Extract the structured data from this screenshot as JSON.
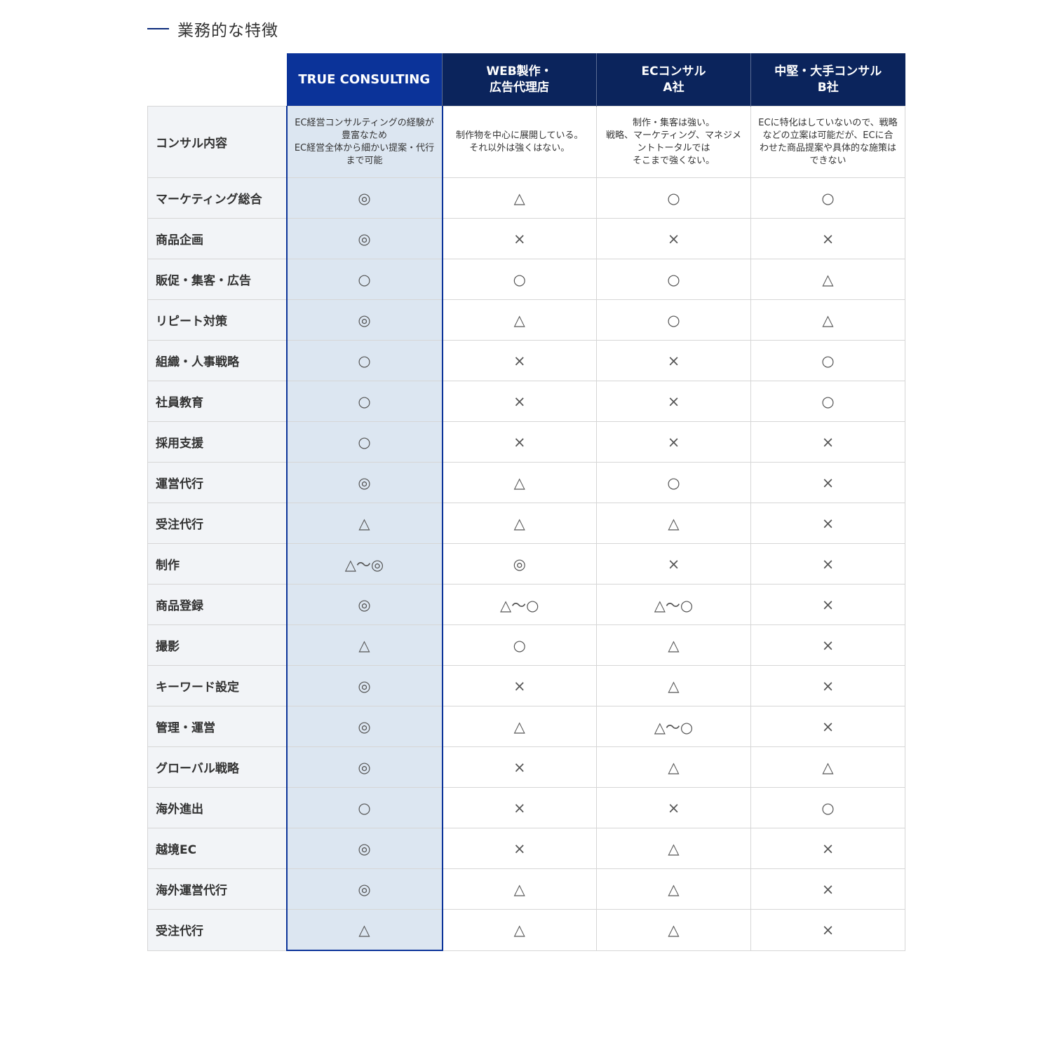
{
  "heading": "業務的な特徴",
  "columns": [
    {
      "line1": "TRUE CONSULTING",
      "line2": ""
    },
    {
      "line1": "WEB製作・",
      "line2": "広告代理店"
    },
    {
      "line1": "ECコンサル",
      "line2": "A社"
    },
    {
      "line1": "中堅・大手コンサル",
      "line2": "B社"
    }
  ],
  "description_row": {
    "label": "コンサル内容",
    "cells": [
      "EC経営コンサルティングの経験が豊富なため\nEC経営全体から細かい提案・代行まで可能",
      "制作物を中心に展開している。\nそれ以外は強くはない。",
      "制作・集客は強い。\n戦略、マーケティング、マネジメントトータルでは\nそこまで強くない。",
      "ECに特化はしていないので、戦略などの立案は可能だが、ECに合わせた商品提案や具体的な施策はできない"
    ]
  },
  "rows": [
    {
      "label": "マーケティング総合",
      "cells": [
        "◎",
        "△",
        "○",
        "○"
      ]
    },
    {
      "label": "商品企画",
      "cells": [
        "◎",
        "×",
        "×",
        "×"
      ]
    },
    {
      "label": "販促・集客・広告",
      "cells": [
        "○",
        "○",
        "○",
        "△"
      ]
    },
    {
      "label": "リピート対策",
      "cells": [
        "◎",
        "△",
        "○",
        "△"
      ]
    },
    {
      "label": "組織・人事戦略",
      "cells": [
        "○",
        "×",
        "×",
        "○"
      ]
    },
    {
      "label": "社員教育",
      "cells": [
        "○",
        "×",
        "×",
        "○"
      ]
    },
    {
      "label": "採用支援",
      "cells": [
        "○",
        "×",
        "×",
        "×"
      ]
    },
    {
      "label": "運営代行",
      "cells": [
        "◎",
        "△",
        "○",
        "×"
      ]
    },
    {
      "label": "受注代行",
      "cells": [
        "△",
        "△",
        "△",
        "×"
      ]
    },
    {
      "label": "制作",
      "cells": [
        "△〜◎",
        "◎",
        "×",
        "×"
      ]
    },
    {
      "label": "商品登録",
      "cells": [
        "◎",
        "△〜○",
        "△〜○",
        "×"
      ]
    },
    {
      "label": "撮影",
      "cells": [
        "△",
        "○",
        "△",
        "×"
      ]
    },
    {
      "label": "キーワード設定",
      "cells": [
        "◎",
        "×",
        "△",
        "×"
      ]
    },
    {
      "label": "管理・運営",
      "cells": [
        "◎",
        "△",
        "△〜○",
        "×"
      ]
    },
    {
      "label": "グローバル戦略",
      "cells": [
        "◎",
        "×",
        "△",
        "△"
      ]
    },
    {
      "label": "海外進出",
      "cells": [
        "○",
        "×",
        "×",
        "○"
      ]
    },
    {
      "label": "越境EC",
      "cells": [
        "◎",
        "×",
        "△",
        "×"
      ]
    },
    {
      "label": "海外運営代行",
      "cells": [
        "◎",
        "△",
        "△",
        "×"
      ]
    },
    {
      "label": "受注代行",
      "cells": [
        "△",
        "△",
        "△",
        "×"
      ]
    }
  ]
}
